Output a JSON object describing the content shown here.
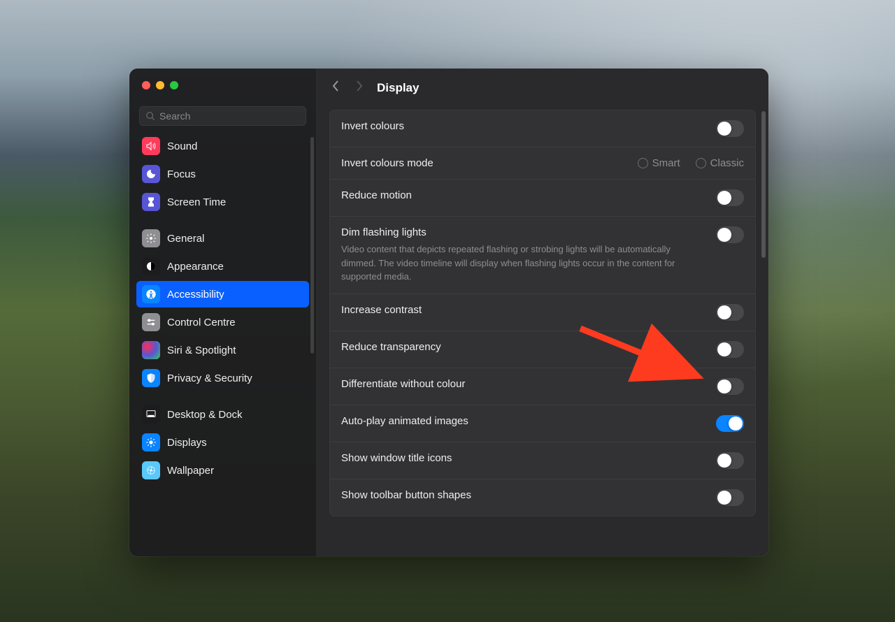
{
  "search": {
    "placeholder": "Search"
  },
  "header": {
    "title": "Display"
  },
  "sidebar": {
    "items": [
      {
        "label": "Sound"
      },
      {
        "label": "Focus"
      },
      {
        "label": "Screen Time"
      },
      {
        "label": "General"
      },
      {
        "label": "Appearance"
      },
      {
        "label": "Accessibility"
      },
      {
        "label": "Control Centre"
      },
      {
        "label": "Siri & Spotlight"
      },
      {
        "label": "Privacy & Security"
      },
      {
        "label": "Desktop & Dock"
      },
      {
        "label": "Displays"
      },
      {
        "label": "Wallpaper"
      }
    ]
  },
  "settings": {
    "invert_colours": "Invert colours",
    "invert_colours_mode": "Invert colours mode",
    "smart": "Smart",
    "classic": "Classic",
    "reduce_motion": "Reduce motion",
    "dim_flashing": "Dim flashing lights",
    "dim_flashing_desc": "Video content that depicts repeated flashing or strobing lights will be automatically dimmed. The video timeline will display when flashing lights occur in the content for supported media.",
    "increase_contrast": "Increase contrast",
    "reduce_transparency": "Reduce transparency",
    "differentiate_without_colour": "Differentiate without colour",
    "auto_play_animated": "Auto-play animated images",
    "show_window_title_icons": "Show window title icons",
    "show_toolbar_button_shapes": "Show toolbar button shapes"
  }
}
